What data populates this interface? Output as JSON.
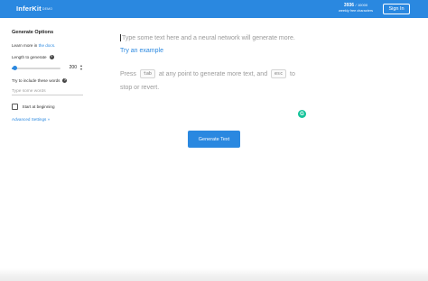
{
  "header": {
    "logo": "InferKit",
    "logo_badge": "DEMO",
    "credits_used": "3936",
    "credits_separator": "/",
    "credits_total": "10000",
    "credits_caption": "weekly free characters",
    "signin_label": "Sign In"
  },
  "sidebar": {
    "title": "Generate Options",
    "learn_prefix": "Learn more in ",
    "learn_link": "the docs.",
    "length_label": "Length to generate",
    "length_value": "200",
    "length_fraction": 0.07,
    "include_label": "Try to include these words",
    "include_placeholder": "Type some words",
    "start_label": "Start at beginning",
    "start_checked": false,
    "advanced_label": "Advanced Settings »"
  },
  "editor": {
    "placeholder": "Type some text here and a neural network will generate more.",
    "try_example": "Try an example",
    "hint_press": "Press",
    "hint_key_tab": "tab",
    "hint_middle": "at any point to generate more text, and",
    "hint_key_esc": "esc",
    "hint_end": "to stop or revert."
  },
  "actions": {
    "generate_label": "Generate Text"
  },
  "colors": {
    "accent": "#2a88e0",
    "grammarly": "#15c39a"
  },
  "icons": {
    "help": "question-circle-icon",
    "spinner": "up-down-arrows-icon",
    "grammarly": "grammarly-icon"
  }
}
